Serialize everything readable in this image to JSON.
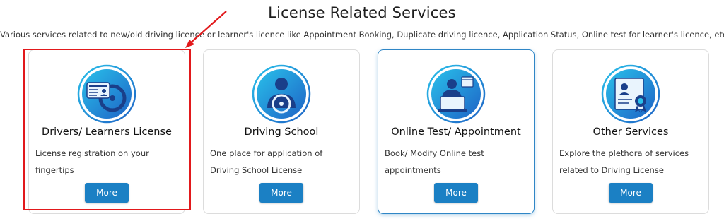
{
  "section": {
    "title": "License Related Services",
    "subtitle": "Various services related to new/old driving licence or learner's licence like Appointment Booking, Duplicate driving licence, Application Status, Online test for learner's licence, etc."
  },
  "cards": [
    {
      "title": "Drivers/ Learners License",
      "description": "License registration on your fingertips",
      "button": "More",
      "icon": "license-steering-icon"
    },
    {
      "title": "Driving School",
      "description": "One place for application of Driving School License",
      "button": "More",
      "icon": "driver-steering-icon"
    },
    {
      "title": "Online Test/ Appointment",
      "description": "Book/ Modify Online test appointments",
      "button": "More",
      "icon": "online-appointment-icon"
    },
    {
      "title": "Other Services",
      "description": "Explore the plethora of services related to Driving License",
      "button": "More",
      "icon": "certificate-icon"
    }
  ],
  "colors": {
    "accent": "#1b80c4",
    "icon_gradient_start": "#29c0ea",
    "icon_gradient_end": "#1e63c6",
    "highlight": "#e2191c"
  }
}
